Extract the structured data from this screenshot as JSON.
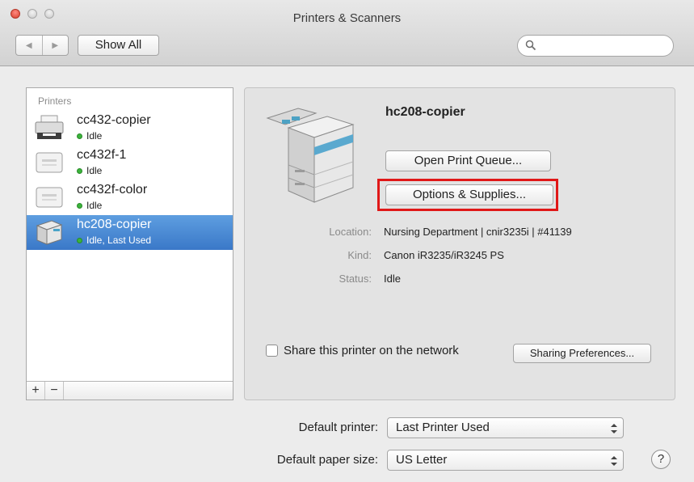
{
  "window": {
    "title": "Printers & Scanners"
  },
  "toolbar": {
    "show_all_label": "Show All",
    "search_placeholder": ""
  },
  "printers": {
    "heading": "Printers",
    "items": [
      {
        "name": "cc432-copier",
        "status": "Idle"
      },
      {
        "name": "cc432f-1",
        "status": "Idle"
      },
      {
        "name": "cc432f-color",
        "status": "Idle"
      },
      {
        "name": "hc208-copier",
        "status": "Idle, Last Used"
      }
    ],
    "add_label": "+",
    "remove_label": "−"
  },
  "detail": {
    "name": "hc208-copier",
    "open_queue_label": "Open Print Queue...",
    "options_label": "Options & Supplies...",
    "location_key": "Location:",
    "location_value": "Nursing Department | cnir3235i | #41139",
    "kind_key": "Kind:",
    "kind_value": "Canon iR3235/iR3245 PS",
    "status_key": "Status:",
    "status_value": "Idle",
    "share_label": "Share this printer on the network",
    "sharing_prefs_label": "Sharing Preferences..."
  },
  "defaults": {
    "printer_label": "Default printer:",
    "printer_value": "Last Printer Used",
    "paper_label": "Default paper size:",
    "paper_value": "US Letter"
  },
  "help_label": "?",
  "colors": {
    "selection": "#3a78c8",
    "highlight_box": "#e01818",
    "idle_dot": "#3bb43b"
  }
}
